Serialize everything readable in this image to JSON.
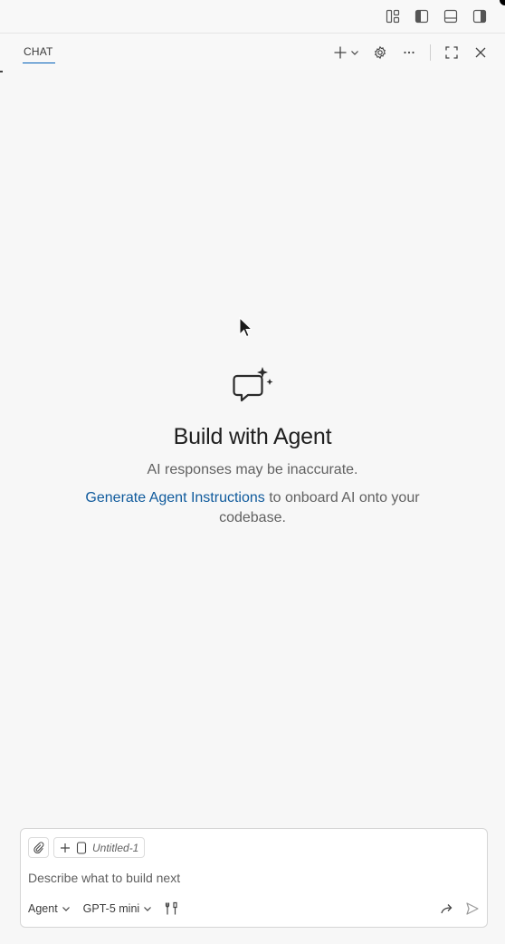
{
  "chat": {
    "tab_label": "CHAT"
  },
  "empty_state": {
    "title": "Build with Agent",
    "subtitle": "AI responses may be inaccurate.",
    "instructions_link": "Generate Agent Instructions",
    "instructions_rest": " to onboard AI onto your codebase."
  },
  "input": {
    "attached_file": "Untitled-1",
    "placeholder": "Describe what to build next",
    "mode": "Agent",
    "model": "GPT-5 mini"
  },
  "icons": {
    "layout": [
      "customize-layout-icon",
      "toggle-primary-sidebar-icon",
      "toggle-panel-icon",
      "toggle-secondary-sidebar-icon"
    ],
    "header": [
      "new-chat-icon",
      "chevron-down-icon",
      "settings-icon",
      "more-icon",
      "maximize-icon",
      "close-icon"
    ]
  },
  "colors": {
    "accent": "#005fb8",
    "link": "#0f5a9c"
  }
}
